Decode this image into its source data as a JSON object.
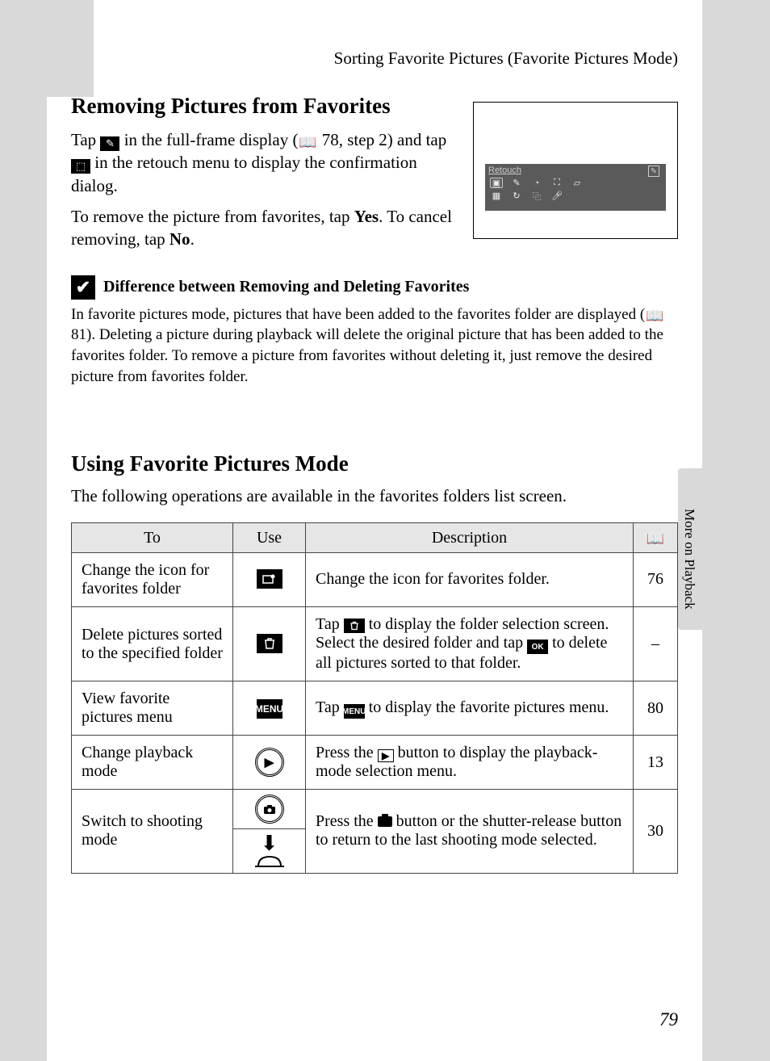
{
  "header": {
    "running_head": "Sorting Favorite Pictures (Favorite Pictures Mode)"
  },
  "section1": {
    "heading": "Removing Pictures from Favorites",
    "p1_a": "Tap ",
    "p1_b": " in the full-frame display (",
    "p1_c": " 78, step 2) and tap ",
    "p1_d": " in the retouch menu to display the confirmation dialog.",
    "p2_a": "To remove the picture from favorites, tap ",
    "p2_yes": "Yes",
    "p2_b": ". To cancel removing, tap ",
    "p2_no": "No",
    "p2_c": "."
  },
  "retouch": {
    "label": "Retouch"
  },
  "note": {
    "title": "Difference between Removing and Deleting Favorites",
    "text_a": "In favorite pictures mode, pictures that have been added to the favorites folder are displayed (",
    "text_b": " 81). Deleting a picture during playback will delete the original picture that has been added to the favorites folder. To remove a picture from favorites without deleting it, just remove the desired picture from favorites folder."
  },
  "section2": {
    "heading": "Using Favorite Pictures Mode",
    "intro": "The following operations are available in the favorites folders list screen."
  },
  "table": {
    "headers": {
      "to": "To",
      "use": "Use",
      "desc": "Description",
      "page_icon": "book"
    },
    "rows": [
      {
        "to": "Change the icon for favorites folder",
        "use_icon": "palette",
        "desc": "Change the icon for favorites folder.",
        "page": "76"
      },
      {
        "to": "Delete pictures sorted to the specified folder",
        "use_icon": "trash",
        "desc_a": "Tap ",
        "desc_b": " to display the folder selection screen. Select the desired folder and tap ",
        "desc_c": " to delete all pictures sorted to that folder.",
        "ok_label": "OK",
        "page": "–"
      },
      {
        "to": "View favorite pictures menu",
        "use_icon": "MENU",
        "desc_a": "Tap ",
        "desc_b": " to display the favorite pictures menu.",
        "menu_label": "MENU",
        "page": "80"
      },
      {
        "to": "Change playback mode",
        "use_icon": "play-circle",
        "desc_a": "Press the ",
        "desc_b": " button to display the playback-mode selection menu.",
        "page": "13"
      },
      {
        "to": "Switch to shooting mode",
        "use_icon": "camera-circle",
        "use_icon2": "shutter",
        "desc_a": "Press the ",
        "desc_b": " button or the shutter-release button to return to the last shooting mode selected.",
        "page": "30"
      }
    ]
  },
  "side": {
    "label": "More on Playback"
  },
  "page_number": "79"
}
